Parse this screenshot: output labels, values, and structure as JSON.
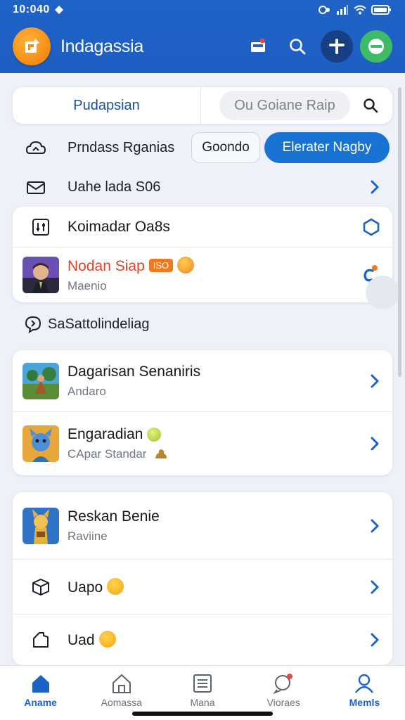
{
  "status_bar": {
    "time": "10:040"
  },
  "header": {
    "title": "Indagassia"
  },
  "search": {
    "segment_label": "Pudapsian",
    "pill_text": "Ou Goiane Raip"
  },
  "row_primary": {
    "label": "Prndass Rganias",
    "secondary_button": "Goondo",
    "primary_button": "Elerater Nagby"
  },
  "row_second": {
    "label": "Uahe lada S06"
  },
  "card_one": {
    "item1": {
      "title": "Koimadar Oa8s"
    },
    "item2": {
      "title": "Nodan Siap",
      "badge": "ISO",
      "subtitle": "Maenio"
    }
  },
  "section": {
    "title": "SaSattolindeliag"
  },
  "card_two": {
    "item1": {
      "title": "Dagarisan Senaniris",
      "subtitle": "Andaro"
    },
    "item2": {
      "title": "Engaradian",
      "subtitle": "CApar Standar"
    }
  },
  "card_three": {
    "item1": {
      "title": "Reskan Benie",
      "subtitle": "Raviine"
    },
    "item2": {
      "title": "Uapo"
    },
    "item3": {
      "title": "Uad"
    }
  },
  "bottom_nav": [
    {
      "label": "Aname",
      "icon": "home-icon",
      "active": true
    },
    {
      "label": "Aomassa",
      "icon": "house-outline-icon",
      "active": false
    },
    {
      "label": "Mana",
      "icon": "list-icon",
      "active": false
    },
    {
      "label": "Vioraes",
      "icon": "chat-icon",
      "active": false
    },
    {
      "label": "Memls",
      "icon": "profile-icon",
      "active": false
    }
  ],
  "colors": {
    "brand": "#1f63c7",
    "accent": "#1873d3",
    "logo": "#f68b12",
    "badge": "#f07a1d"
  }
}
